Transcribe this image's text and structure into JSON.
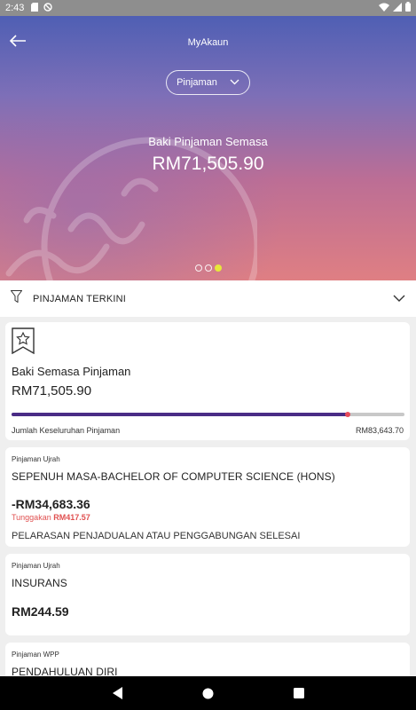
{
  "status_bar": {
    "time": "2:43",
    "icons_left": [
      "sd-card-icon",
      "do-not-disturb-icon"
    ],
    "icons_right": [
      "wifi-icon",
      "signal-icon",
      "battery-icon"
    ]
  },
  "header": {
    "title": "MyAkaun",
    "dropdown_value": "Pinjaman",
    "balance_label": "Baki Pinjaman Semasa",
    "balance_amount": "RM71,505.90",
    "carousel": {
      "count": 3,
      "active_index": 2
    }
  },
  "filter": {
    "label": "PINJAMAN TERKINI"
  },
  "summary_card": {
    "label": "Baki Semasa Pinjaman",
    "amount": "RM71,505.90",
    "progress_fraction": 0.855,
    "total_label": "Jumlah Keseluruhan Pinjaman",
    "total_amount": "RM83,643.70"
  },
  "loans": [
    {
      "type": "Pinjaman Ujrah",
      "title": "SEPENUH MASA-BACHELOR OF COMPUTER SCIENCE (HONS)",
      "amount": "-RM34,683.36",
      "arrears_label": "Tunggakan",
      "arrears_amount": "RM417.57",
      "status": "PELARASAN PENJADUALAN ATAU PENGGABUNGAN SELESAI"
    },
    {
      "type": "Pinjaman Ujrah",
      "title": "INSURANS",
      "amount": "RM244.59"
    },
    {
      "type": "Pinjaman WPP",
      "title": "PENDAHULUAN DIRI"
    }
  ],
  "colors": {
    "progress_fill": "#4a2c86",
    "progress_marker": "#e84b5a",
    "arrears": "#e05050",
    "active_dot": "#e7e83a"
  }
}
